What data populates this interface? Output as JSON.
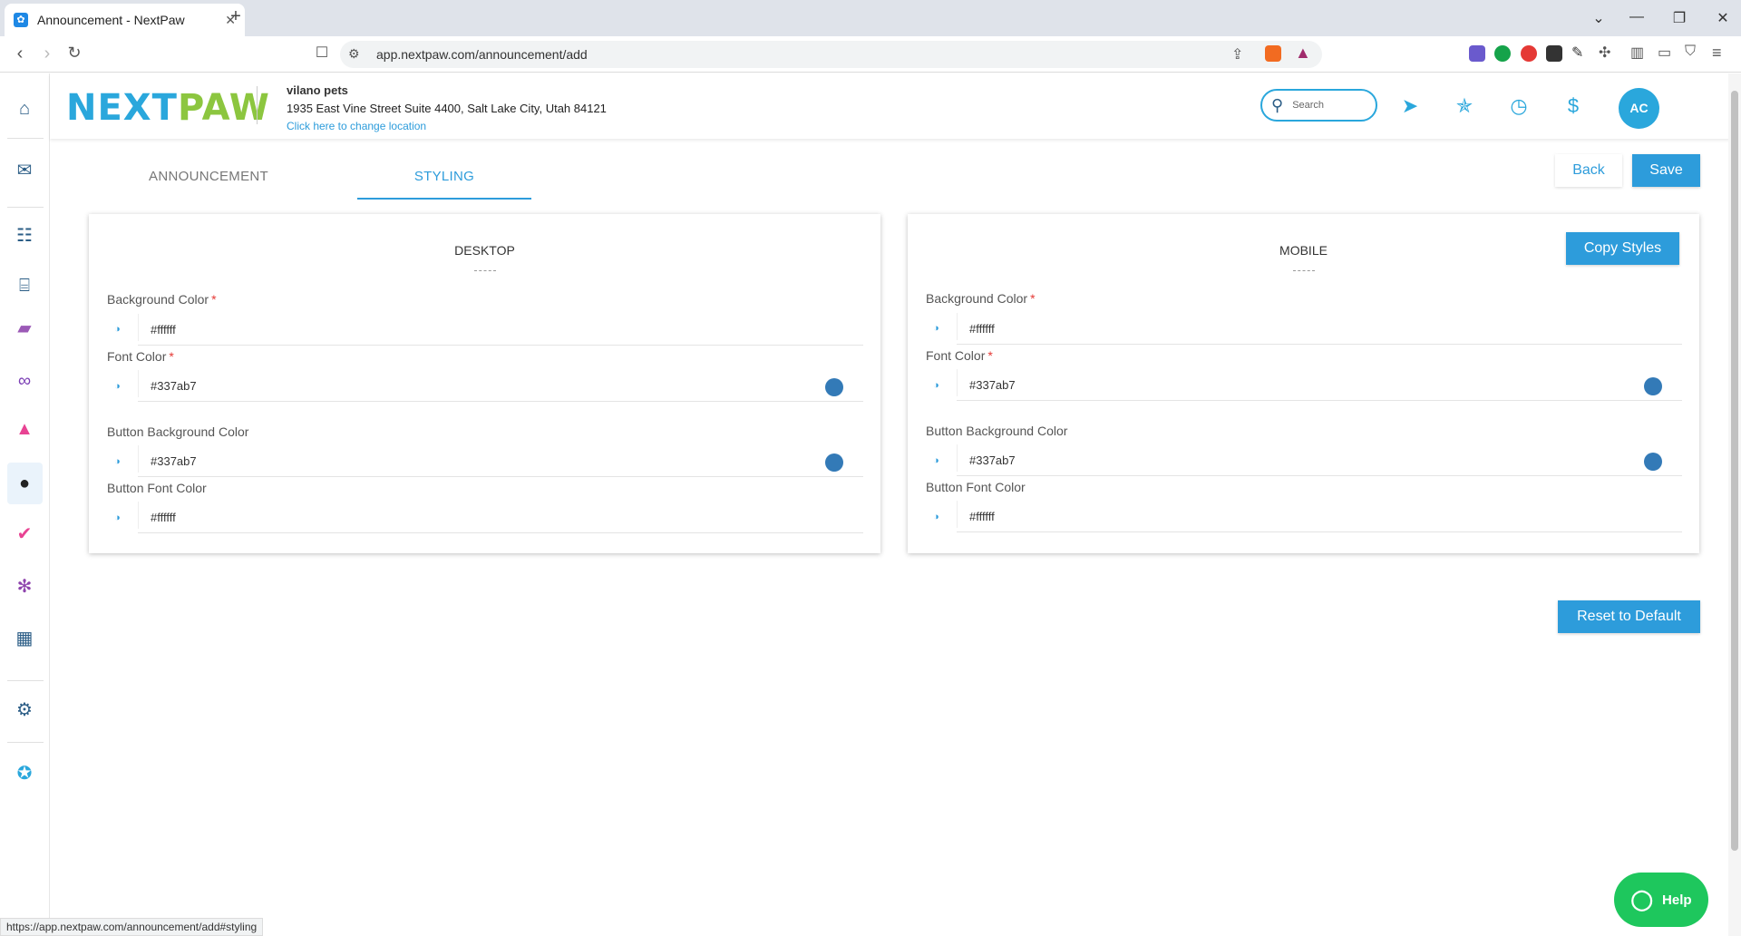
{
  "browser": {
    "tab_title": "Announcement - NextPaw",
    "tab_close": "✕",
    "new_tab": "+",
    "url": "app.nextpaw.com/announcement/add",
    "status_url": "https://app.nextpaw.com/announcement/add#styling"
  },
  "header": {
    "logo_main": "NEXT",
    "logo_paw": "PAW",
    "business_name": "vilano pets",
    "business_address": "1935 East Vine Street Suite 4400, Salt Lake City, Utah 84121",
    "change_location": "Click here to change location",
    "search_placeholder": "Search",
    "avatar_initials": "AC"
  },
  "tabs": [
    {
      "label": "ANNOUNCEMENT",
      "active": false
    },
    {
      "label": "STYLING",
      "active": true
    }
  ],
  "actions": {
    "back": "Back",
    "save": "Save",
    "copy_styles": "Copy Styles",
    "reset": "Reset to Default",
    "help": "Help"
  },
  "desktop": {
    "title": "DESKTOP",
    "fields": [
      {
        "label": "Background Color",
        "required": "*",
        "value": "#ffffff"
      },
      {
        "label": "Font Color",
        "required": "*",
        "value": "#337ab7"
      },
      {
        "label": "Button Background Color",
        "required": "",
        "value": "#337ab7"
      },
      {
        "label": "Button Font Color",
        "required": "",
        "value": "#ffffff"
      }
    ]
  },
  "mobile": {
    "title": "MOBILE",
    "fields": [
      {
        "label": "Background Color",
        "required": "*",
        "value": "#ffffff"
      },
      {
        "label": "Font Color",
        "required": "*",
        "value": "#337ab7"
      },
      {
        "label": "Button Background Color",
        "required": "",
        "value": "#337ab7"
      },
      {
        "label": "Button Font Color",
        "required": "",
        "value": "#ffffff"
      }
    ]
  },
  "colors": {
    "accent": "#2d9cdb",
    "swatch": "#337ab7",
    "help": "#1ec75d",
    "required": "#e53935"
  }
}
